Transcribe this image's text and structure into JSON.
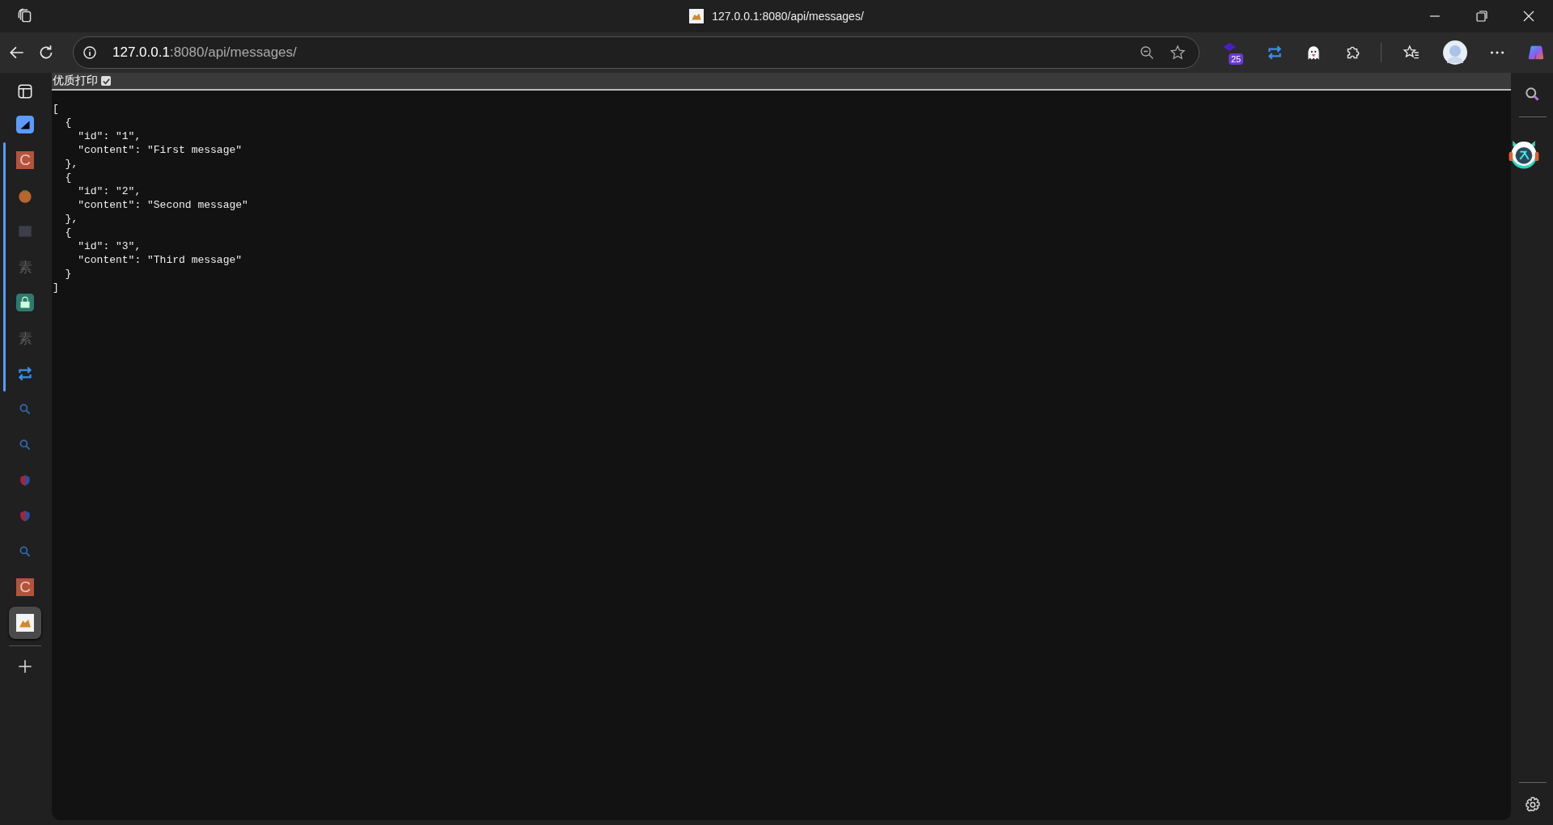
{
  "window": {
    "title": "127.0.0.1:8080/api/messages/"
  },
  "address_bar": {
    "host": "127.0.0.1",
    "path": ":8080/api/messages/"
  },
  "extensions": [
    {
      "kind": "stack",
      "badge": "25"
    },
    {
      "kind": "repeat"
    },
    {
      "kind": "ghost"
    },
    {
      "kind": "puzzle"
    }
  ],
  "pinned_tabs": [
    {
      "kind": "pinned",
      "selected": false
    }
  ],
  "tab_group": [
    {
      "kind": "letter",
      "glyph": "C",
      "color": "#b5523b",
      "selected": false
    },
    {
      "kind": "tomato",
      "selected": false
    },
    {
      "kind": "dim",
      "selected": false
    },
    {
      "kind": "text",
      "glyph": "素",
      "selected": false
    },
    {
      "kind": "lock",
      "selected": false
    },
    {
      "kind": "text",
      "glyph": "素",
      "selected": false
    },
    {
      "kind": "repeat",
      "selected": false
    }
  ],
  "vertical_tabs": [
    {
      "kind": "search",
      "selected": false
    },
    {
      "kind": "search",
      "selected": false
    },
    {
      "kind": "shield",
      "selected": false
    },
    {
      "kind": "shield",
      "selected": false
    },
    {
      "kind": "search",
      "selected": false
    },
    {
      "kind": "letter",
      "glyph": "C",
      "color": "#b5523b",
      "selected": false
    },
    {
      "kind": "cat",
      "selected": true
    }
  ],
  "page": {
    "print_label": "优质打印",
    "print_checked": true,
    "json_lines": [
      "[",
      "  {",
      "    \"id\": \"1\",",
      "    \"content\": \"First message\"",
      "  },",
      "  {",
      "    \"id\": \"2\",",
      "    \"content\": \"Second message\"",
      "  },",
      "  {",
      "    \"id\": \"3\",",
      "    \"content\": \"Third message\"",
      "  }",
      "]"
    ]
  }
}
